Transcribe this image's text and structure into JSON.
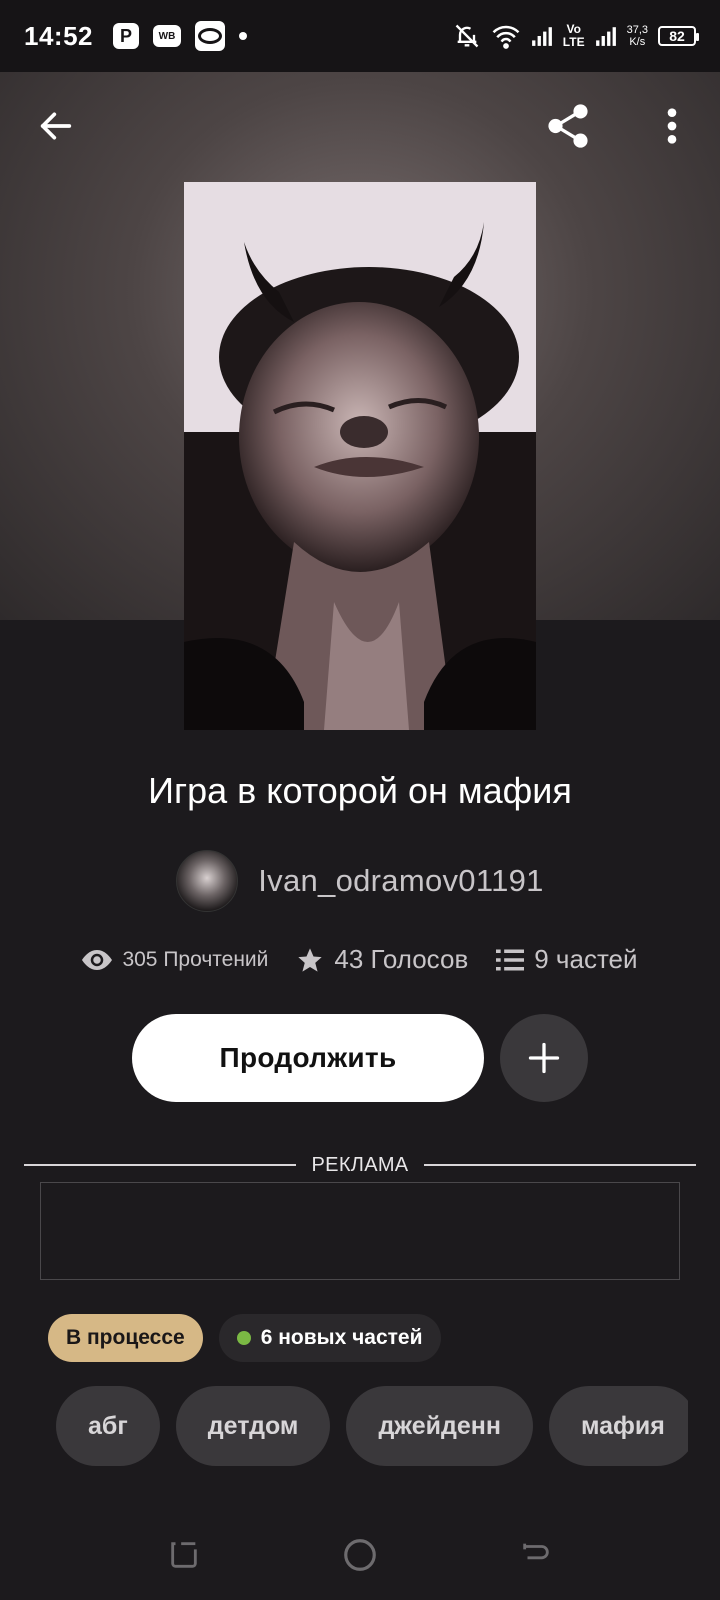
{
  "status_bar": {
    "time": "14:52",
    "app_icons": [
      "p-app-icon",
      "wb-app-icon",
      "o-app-icon"
    ],
    "network_top": "Vo",
    "network_bottom": "LTE",
    "speed_value": "37,3",
    "speed_unit": "K/s",
    "battery": "82"
  },
  "story": {
    "title": "Игра в которой он мафия",
    "author": "Ivan_odramov01191",
    "reads": "305 Прочтений",
    "votes": "43 Голосов",
    "parts": "9 частей"
  },
  "actions": {
    "continue_label": "Продолжить"
  },
  "ad": {
    "label": "РЕКЛАМА"
  },
  "badges": {
    "status": "В процессе",
    "new_parts": "6 новых частей"
  },
  "tags": [
    "абг",
    "детдом",
    "джейденн",
    "мафия"
  ],
  "colors": {
    "background": "#1c1a1d",
    "status_badge": "#d6b886",
    "new_dot": "#7bb944",
    "chip": "#3a383b"
  }
}
